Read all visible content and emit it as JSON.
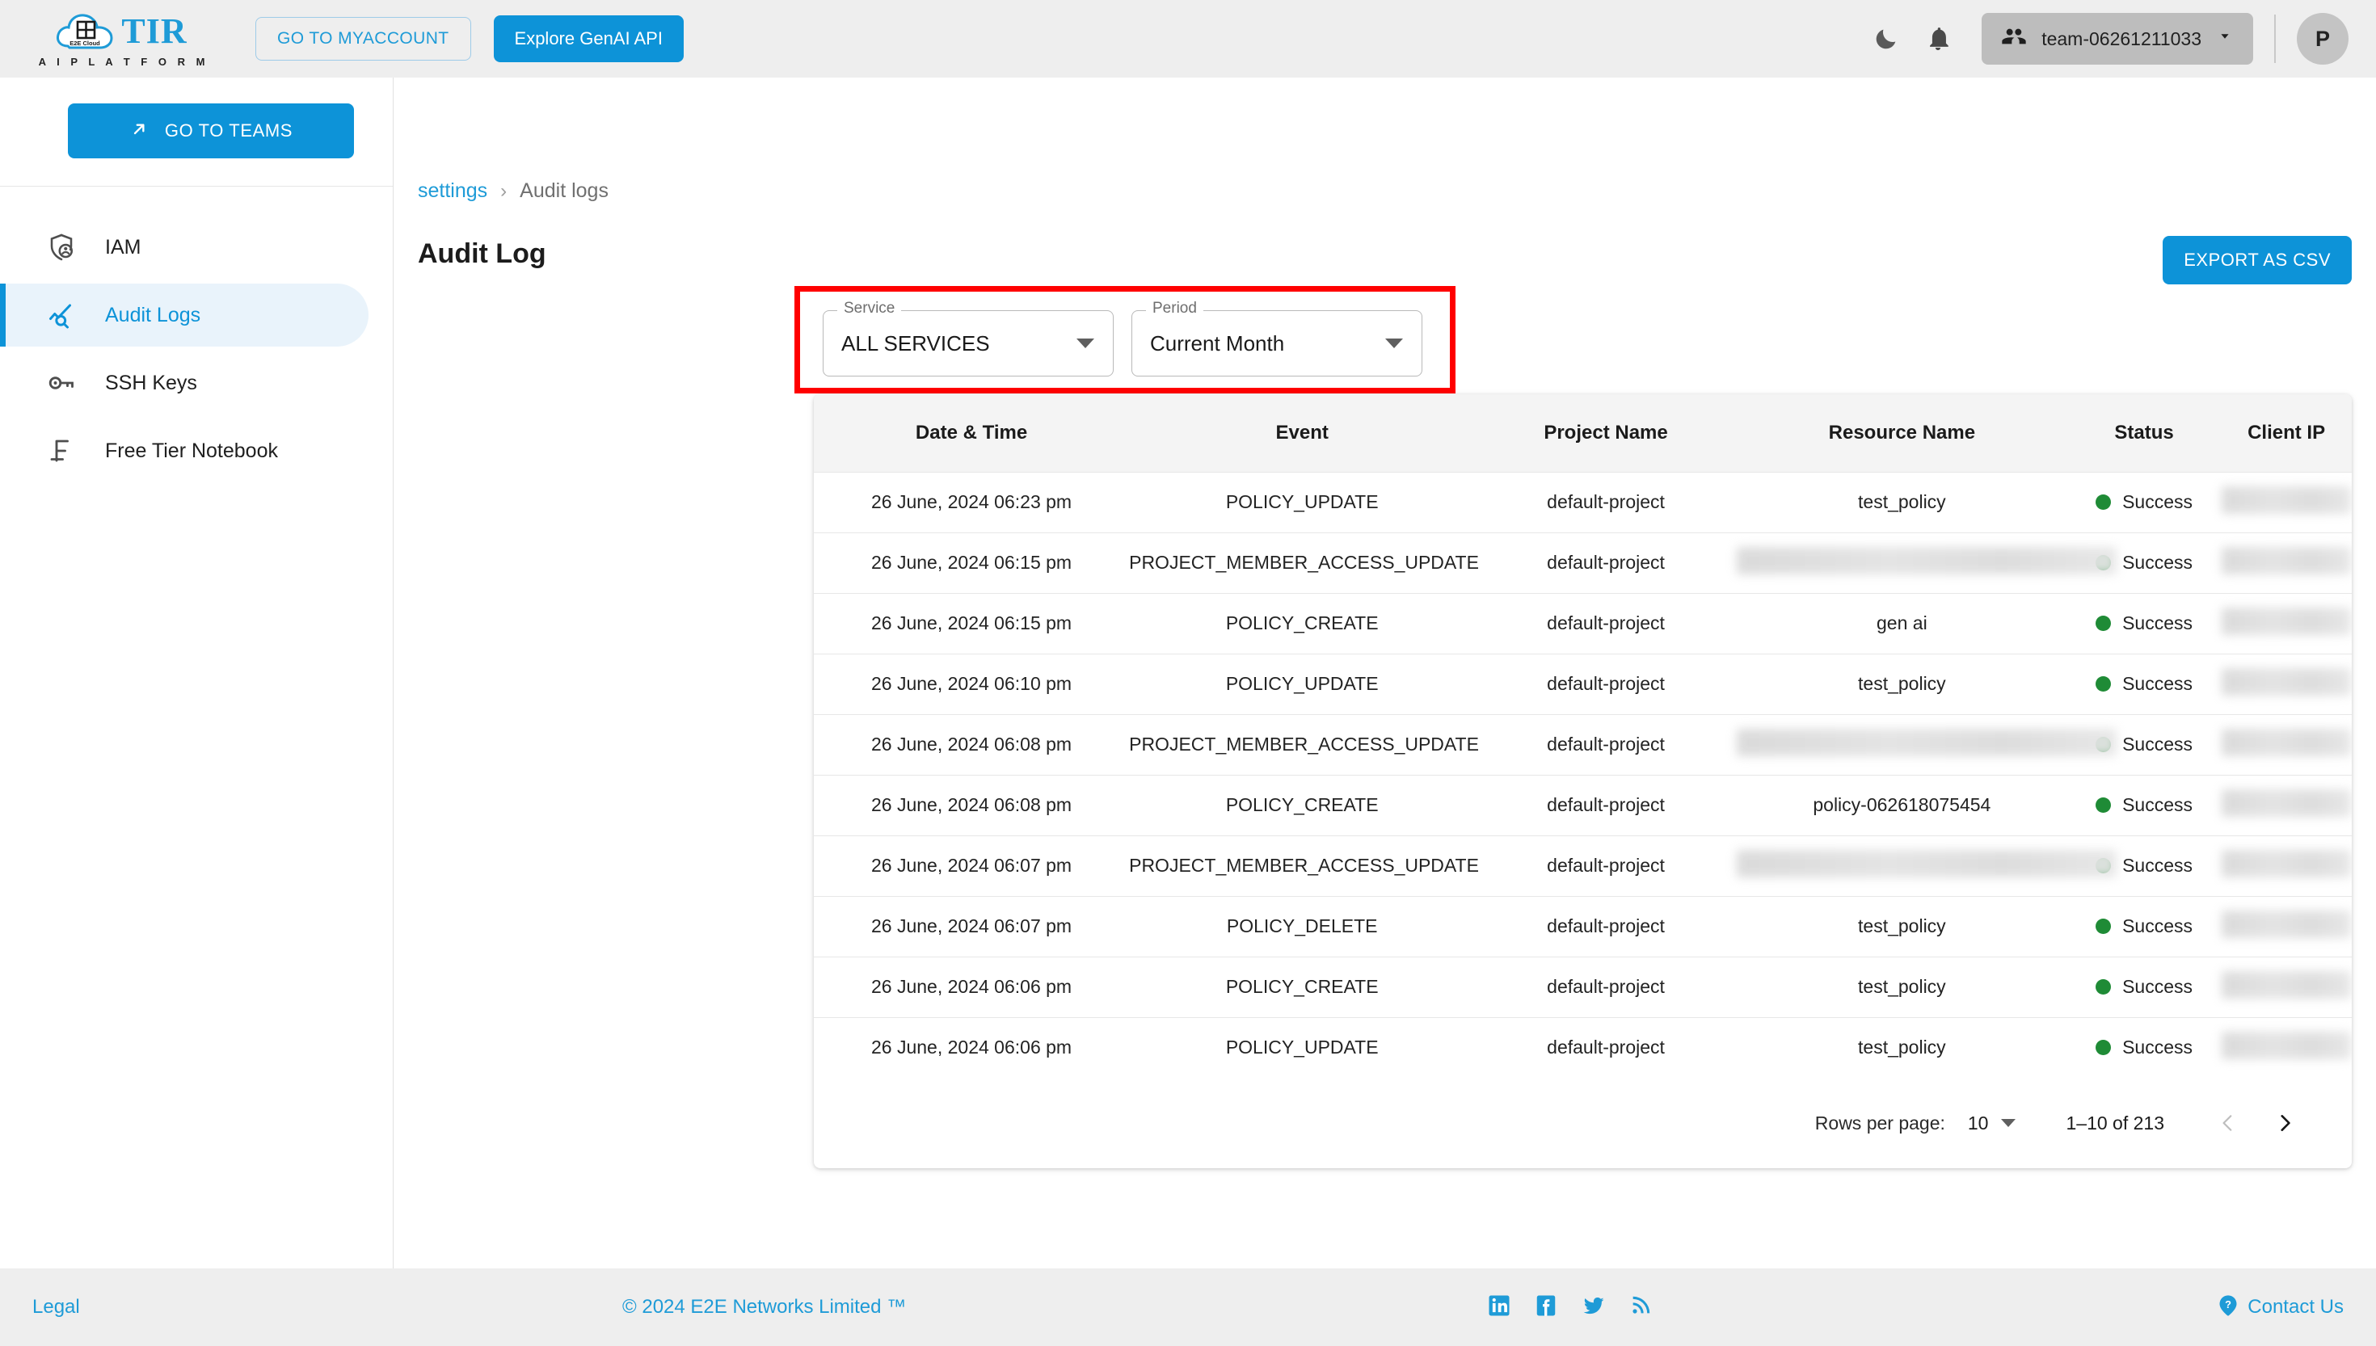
{
  "topbar": {
    "logo_title": "TIR",
    "logo_subtitle": "A I   P L A T F O R M",
    "logo_cloud_label": "E2E Cloud",
    "myaccount_label": "GO TO MYACCOUNT",
    "genai_label": "Explore GenAI API",
    "team_label": "team-06261211033",
    "avatar_initial": "P",
    "dark_mode_icon": "moon-icon",
    "notifications_icon": "bell-icon",
    "team_icon": "people-icon",
    "team_caret_icon": "chevron-down-icon"
  },
  "sidebar": {
    "teams_button_label": "GO TO TEAMS",
    "teams_button_icon": "arrow-up-right-icon",
    "items": [
      {
        "label": "IAM",
        "icon": "shield-person-icon",
        "active": false
      },
      {
        "label": "Audit Logs",
        "icon": "analytics-search-icon",
        "active": true
      },
      {
        "label": "SSH Keys",
        "icon": "key-icon",
        "active": false
      },
      {
        "label": "Free Tier Notebook",
        "icon": "free-tier-icon",
        "active": false
      }
    ]
  },
  "breadcrumb": {
    "parent": "settings",
    "separator": "›",
    "current": "Audit logs"
  },
  "page": {
    "title": "Audit Log",
    "export_label": "EXPORT AS CSV"
  },
  "filters": {
    "service": {
      "label": "Service",
      "value": "ALL SERVICES"
    },
    "period": {
      "label": "Period",
      "value": "Current Month"
    }
  },
  "table": {
    "columns": [
      "Date & Time",
      "Event",
      "Project Name",
      "Resource Name",
      "Status",
      "Client IP"
    ],
    "rows": [
      {
        "datetime": "26 June, 2024 06:23 pm",
        "event": "POLICY_UPDATE",
        "project": "default-project",
        "resource": "test_policy",
        "resource_redacted": false,
        "status": "Success",
        "client_ip": "",
        "ip_redacted": true
      },
      {
        "datetime": "26 June, 2024 06:15 pm",
        "event": "PROJECT_MEMBER_ACCESS_UPDATE",
        "project": "default-project",
        "resource": "",
        "resource_redacted": true,
        "status": "Success",
        "client_ip": "",
        "ip_redacted": true
      },
      {
        "datetime": "26 June, 2024 06:15 pm",
        "event": "POLICY_CREATE",
        "project": "default-project",
        "resource": "gen ai",
        "resource_redacted": false,
        "status": "Success",
        "client_ip": "",
        "ip_redacted": true
      },
      {
        "datetime": "26 June, 2024 06:10 pm",
        "event": "POLICY_UPDATE",
        "project": "default-project",
        "resource": "test_policy",
        "resource_redacted": false,
        "status": "Success",
        "client_ip": "",
        "ip_redacted": true
      },
      {
        "datetime": "26 June, 2024 06:08 pm",
        "event": "PROJECT_MEMBER_ACCESS_UPDATE",
        "project": "default-project",
        "resource": "",
        "resource_redacted": true,
        "status": "Success",
        "client_ip": "",
        "ip_redacted": true
      },
      {
        "datetime": "26 June, 2024 06:08 pm",
        "event": "POLICY_CREATE",
        "project": "default-project",
        "resource": "policy-062618075454",
        "resource_redacted": false,
        "status": "Success",
        "client_ip": "",
        "ip_redacted": true
      },
      {
        "datetime": "26 June, 2024 06:07 pm",
        "event": "PROJECT_MEMBER_ACCESS_UPDATE",
        "project": "default-project",
        "resource": "",
        "resource_redacted": true,
        "status": "Success",
        "client_ip": "",
        "ip_redacted": true
      },
      {
        "datetime": "26 June, 2024 06:07 pm",
        "event": "POLICY_DELETE",
        "project": "default-project",
        "resource": "test_policy",
        "resource_redacted": false,
        "status": "Success",
        "client_ip": "",
        "ip_redacted": true
      },
      {
        "datetime": "26 June, 2024 06:06 pm",
        "event": "POLICY_CREATE",
        "project": "default-project",
        "resource": "test_policy",
        "resource_redacted": false,
        "status": "Success",
        "client_ip": "",
        "ip_redacted": true
      },
      {
        "datetime": "26 June, 2024 06:06 pm",
        "event": "POLICY_UPDATE",
        "project": "default-project",
        "resource": "test_policy",
        "resource_redacted": false,
        "status": "Success",
        "client_ip": "",
        "ip_redacted": true
      }
    ]
  },
  "pagination": {
    "rows_per_page_label": "Rows per page:",
    "rows_per_page_value": "10",
    "range_label": "1–10 of 213",
    "prev_icon": "chevron-left-icon",
    "next_icon": "chevron-right-icon"
  },
  "footer": {
    "legal": "Legal",
    "copyright": "© 2024 E2E Networks Limited ™",
    "contact": "Contact Us",
    "social": [
      "linkedin-icon",
      "facebook-icon",
      "twitter-icon",
      "rss-icon"
    ]
  },
  "annotation": {
    "highlight_color": "#FF0000",
    "target": "filters-region"
  },
  "colors": {
    "accent": "#0d93d8",
    "link": "#1E9BD7",
    "success": "#1F8B36",
    "page_bg": "#eeeeee",
    "table_header_bg": "#f4f4f4"
  }
}
